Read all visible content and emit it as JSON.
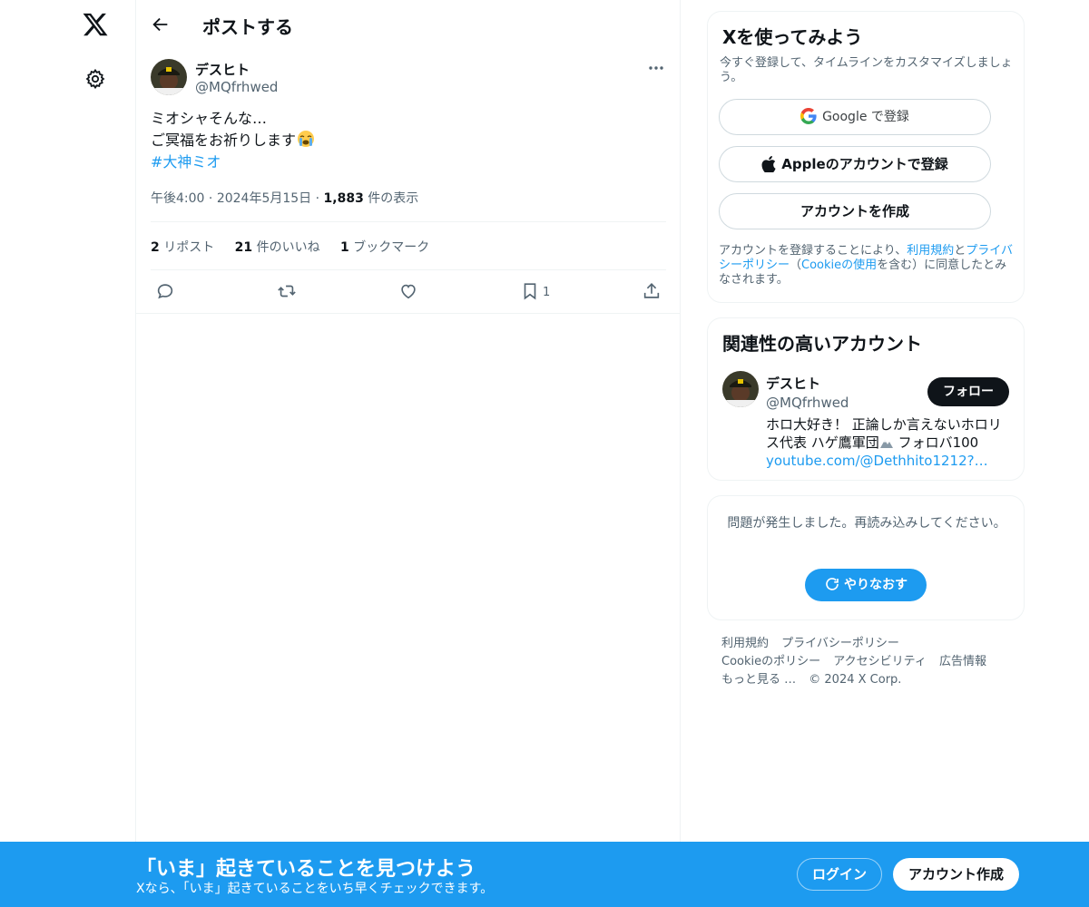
{
  "colors": {
    "accent": "#1d9bf0",
    "text_primary": "#0f1419",
    "text_secondary": "#536471",
    "border": "#eff3f4",
    "dark_button": "#0f1419"
  },
  "nav": {
    "logo_icon": "x-logo-icon",
    "settings_icon": "gear-icon"
  },
  "header": {
    "back_icon": "arrow-left-icon",
    "title": "ポストする"
  },
  "post": {
    "author_name": "デスヒト",
    "author_handle": "@MQfrhwed",
    "more_icon": "more-dots-icon",
    "text_line1": "ミオシャそんな…",
    "text_line2": "ご冥福をお祈りします",
    "text_emoji": "loudly-crying-face",
    "hashtag": "#大神ミオ",
    "time": "午後4:00",
    "date": "2024年5月15日",
    "views_count": "1,883",
    "views_label": "件の表示",
    "reposts_count": "2",
    "reposts_label": "リポスト",
    "likes_count": "21",
    "likes_label": "件のいいね",
    "bookmarks_count": "1",
    "bookmarks_label": "ブックマーク",
    "action_bookmark_count": "1"
  },
  "signup_card": {
    "title": "Xを使ってみよう",
    "subtitle": "今すぐ登録して、タイムラインをカスタマイズしましょう。",
    "google_label": "Google で登録",
    "apple_label": "Appleのアカウントで登録",
    "create_label": "アカウントを作成",
    "legal_prefix": "アカウントを登録することにより、",
    "legal_terms": "利用規約",
    "legal_and": "と",
    "legal_privacy": "プライバシーポリシー",
    "legal_open": "（",
    "legal_cookie": "Cookieの使用",
    "legal_suffix": "を含む）に同意したとみなされます。"
  },
  "related_card": {
    "title": "関連性の高いアカウント",
    "name": "デスヒト",
    "handle": "@MQfrhwed",
    "follow_label": "フォロー",
    "bio_part1": "ホロ大好き！ 正論しか言えないホロリス代表 ハゲ鷹軍団",
    "bio_part2": "フォロバ100",
    "link": "youtube.com/@Dethhito1212?…"
  },
  "error_card": {
    "message": "問題が発生しました。再読み込みしてください。",
    "retry_label": "やりなおす"
  },
  "footer": {
    "links": [
      "利用規約",
      "プライバシーポリシー",
      "Cookieのポリシー",
      "アクセシビリティ",
      "広告情報",
      "もっと見る …",
      "© 2024 X Corp."
    ]
  },
  "banner": {
    "title": "「いま」起きていることを見つけよう",
    "subtitle": "Xなら、「いま」起きていることをいち早くチェックできます。",
    "login_label": "ログイン",
    "signup_label": "アカウント作成"
  }
}
